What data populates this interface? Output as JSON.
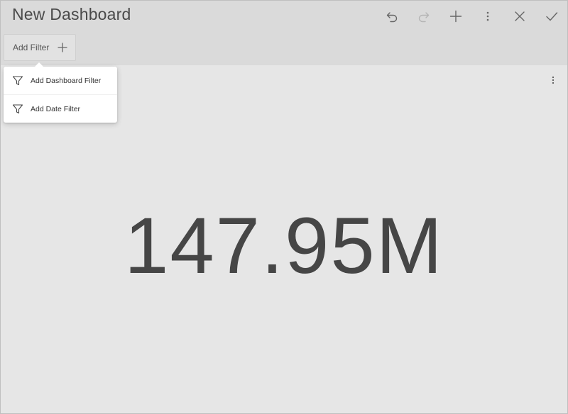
{
  "header": {
    "title": "New Dashboard"
  },
  "toolbar": {
    "buttons": [
      {
        "icon": "undo-icon"
      },
      {
        "icon": "redo-icon",
        "disabled": true
      },
      {
        "icon": "add-icon"
      },
      {
        "icon": "more-vert-icon"
      },
      {
        "icon": "close-icon"
      },
      {
        "icon": "check-icon"
      }
    ]
  },
  "filter_bar": {
    "add_filter_label": "Add Filter"
  },
  "filter_menu": {
    "items": [
      {
        "label": "Add Dashboard Filter",
        "icon": "filter-icon"
      },
      {
        "label": "Add Date Filter",
        "icon": "filter-icon"
      }
    ]
  },
  "widget": {
    "kpi_value": "147.95M"
  },
  "colors": {
    "header_bg": "#dadada",
    "canvas_bg": "#e6e6e6",
    "text": "#464646",
    "icon": "#666666",
    "icon_disabled": "#b5b5b5"
  }
}
